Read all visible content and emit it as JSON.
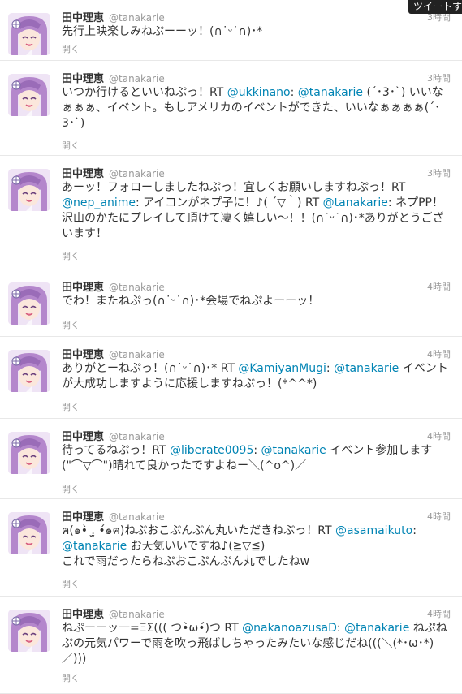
{
  "tooltip": "ツイートす",
  "user": {
    "name": "田中理恵",
    "handle": "@tanakarie"
  },
  "open_label": "開く",
  "tweets": [
    {
      "time": "3時間",
      "parts": [
        {
          "t": "先行上映楽しみねぷーーッ！(∩˙ᵕ˙∩)･*"
        }
      ]
    },
    {
      "time": "3時間",
      "parts": [
        {
          "t": "いつか行けるといいねぷっ！RT "
        },
        {
          "t": "@ukkinano",
          "m": 1
        },
        {
          "t": ": "
        },
        {
          "t": "@tanakarie",
          "m": 1
        },
        {
          "t": " (´･3･`) いいなぁぁぁ、イベント。もしアメリカのイベントができた、いいなぁぁぁぁ(´･3･`)"
        }
      ]
    },
    {
      "time": "3時間",
      "parts": [
        {
          "t": "あーッ！フォローしましたねぷっ！宜しくお願いしますねぷっ！RT "
        },
        {
          "t": "@nep_anime",
          "m": 1
        },
        {
          "t": ": アイコンがネプ子に！♪( ´▽｀) RT "
        },
        {
          "t": "@tanakarie",
          "m": 1
        },
        {
          "t": ": ネプPP！沢山のかたにプレイして頂けて凄く嬉しい〜！！(∩˙ᵕ˙∩)･*ありがとうございます！"
        }
      ]
    },
    {
      "time": "4時間",
      "parts": [
        {
          "t": "でわ！またねぷっ(∩˙ᵕ˙∩)･*会場でねぷよーーッ！"
        }
      ]
    },
    {
      "time": "4時間",
      "parts": [
        {
          "t": "ありがとーねぷっ！(∩˙ᵕ˙∩)･* RT "
        },
        {
          "t": "@KamiyanMugi",
          "m": 1
        },
        {
          "t": ": "
        },
        {
          "t": "@tanakarie",
          "m": 1
        },
        {
          "t": " イベントが大成功しますように応援しますねぷっ！(*^^*)"
        }
      ]
    },
    {
      "time": "4時間",
      "parts": [
        {
          "t": "待ってるねぷっ！RT "
        },
        {
          "t": "@liberate0095",
          "m": 1
        },
        {
          "t": ": "
        },
        {
          "t": "@tanakarie",
          "m": 1
        },
        {
          "t": " イベント参加します(\"⌒▽⌒\")晴れて良かったですよねー＼(^o^)／"
        }
      ]
    },
    {
      "time": "4時間",
      "parts": [
        {
          "t": "ฅ(๑•̀ .̫ •́๑ฅ)ねぷおこぷんぷん丸いただきねぷっ！RT "
        },
        {
          "t": "@asamaikuto",
          "m": 1
        },
        {
          "t": ": "
        },
        {
          "t": "@tanakarie",
          "m": 1
        },
        {
          "t": " お天気いいですね♪(≧▽≦)"
        },
        {
          "t": "\n"
        },
        {
          "t": "これで雨だったらねぷおこぷんぷん丸でしたねw"
        }
      ]
    },
    {
      "time": "4時間",
      "parts": [
        {
          "t": "ねぷーーッ一=ΞΣ((( つ•̀ω•́)つ RT "
        },
        {
          "t": "@nakanoazusaD",
          "m": 1
        },
        {
          "t": ": "
        },
        {
          "t": "@tanakarie",
          "m": 1
        },
        {
          "t": " ねぷねぷの元気パワーで雨を吹っ飛ばしちゃったみたいな感じだね(((＼(*･ω･*)／)))"
        }
      ]
    }
  ]
}
